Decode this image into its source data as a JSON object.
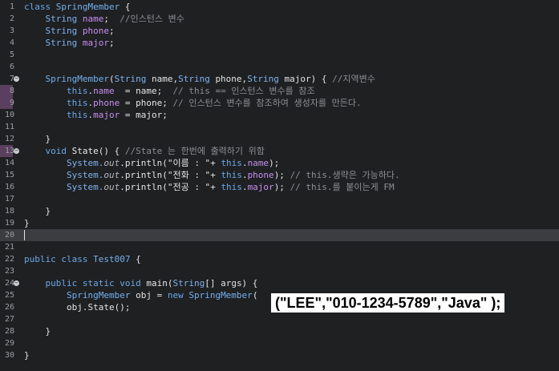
{
  "editor": {
    "lines": [
      {
        "n": "1",
        "fold": false,
        "parts": [
          [
            "kw",
            "class "
          ],
          [
            "cls",
            "SpringMember "
          ],
          [
            "plain",
            "{"
          ]
        ]
      },
      {
        "n": "2",
        "fold": false,
        "parts": [
          [
            "typ",
            "    String "
          ],
          [
            "fld",
            "name"
          ],
          [
            "plain",
            ";  "
          ],
          [
            "cm",
            "//인스턴스 변수"
          ]
        ]
      },
      {
        "n": "3",
        "fold": false,
        "parts": [
          [
            "typ",
            "    String "
          ],
          [
            "fld",
            "phone"
          ],
          [
            "plain",
            ";"
          ]
        ]
      },
      {
        "n": "4",
        "fold": false,
        "parts": [
          [
            "typ",
            "    String "
          ],
          [
            "fld",
            "major"
          ],
          [
            "plain",
            ";"
          ]
        ]
      },
      {
        "n": "5",
        "fold": false,
        "parts": []
      },
      {
        "n": "6",
        "fold": false,
        "parts": []
      },
      {
        "n": "7",
        "fold": true,
        "parts": [
          [
            "cls",
            "    SpringMember"
          ],
          [
            "plain",
            "("
          ],
          [
            "typ",
            "String "
          ],
          [
            "plain",
            "name,"
          ],
          [
            "typ",
            "String "
          ],
          [
            "plain",
            "phone,"
          ],
          [
            "typ",
            "String "
          ],
          [
            "plain",
            "major) { "
          ],
          [
            "cm",
            "//지역변수"
          ]
        ]
      },
      {
        "n": "8",
        "fold": false,
        "mark": true,
        "parts": [
          [
            "kw",
            "        this"
          ],
          [
            "plain",
            "."
          ],
          [
            "fld",
            "name "
          ],
          [
            "plain",
            " = name;  "
          ],
          [
            "cm",
            "// this == 인스턴스 변수를 참조"
          ]
        ]
      },
      {
        "n": "9",
        "fold": false,
        "mark": true,
        "parts": [
          [
            "kw",
            "        this"
          ],
          [
            "plain",
            "."
          ],
          [
            "fld",
            "phone"
          ],
          [
            "plain",
            " = phone; "
          ],
          [
            "cm",
            "// 인스턴스 변수를 참조하여 생성자를 만든다."
          ]
        ]
      },
      {
        "n": "10",
        "fold": false,
        "parts": [
          [
            "kw",
            "        this"
          ],
          [
            "plain",
            "."
          ],
          [
            "fld",
            "major"
          ],
          [
            "plain",
            " = major;"
          ]
        ]
      },
      {
        "n": "11",
        "fold": false,
        "parts": []
      },
      {
        "n": "12",
        "fold": false,
        "parts": [
          [
            "plain",
            "    }"
          ]
        ]
      },
      {
        "n": "13",
        "fold": true,
        "mark": true,
        "parts": [
          [
            "kw",
            "    void "
          ],
          [
            "mth",
            "State"
          ],
          [
            "plain",
            "() { "
          ],
          [
            "cm",
            "//State 는 한번에 출력하기 위함"
          ]
        ]
      },
      {
        "n": "14",
        "fold": false,
        "parts": [
          [
            "typ",
            "        System."
          ],
          [
            "it",
            "out"
          ],
          [
            "plain",
            ".println("
          ],
          [
            "str",
            "\"이름 : \""
          ],
          [
            "plain",
            "+ "
          ],
          [
            "kw",
            "this"
          ],
          [
            "plain",
            "."
          ],
          [
            "fld",
            "name"
          ],
          [
            "plain",
            ");"
          ]
        ]
      },
      {
        "n": "15",
        "fold": false,
        "parts": [
          [
            "typ",
            "        System."
          ],
          [
            "it",
            "out"
          ],
          [
            "plain",
            ".println("
          ],
          [
            "str",
            "\"전화 : \""
          ],
          [
            "plain",
            "+ "
          ],
          [
            "kw",
            "this"
          ],
          [
            "plain",
            "."
          ],
          [
            "fld",
            "phone"
          ],
          [
            "plain",
            "); "
          ],
          [
            "cm",
            "// this.생략은 가능하다."
          ]
        ]
      },
      {
        "n": "16",
        "fold": false,
        "parts": [
          [
            "typ",
            "        System."
          ],
          [
            "it",
            "out"
          ],
          [
            "plain",
            ".println("
          ],
          [
            "str",
            "\"전공 : \""
          ],
          [
            "plain",
            "+ "
          ],
          [
            "kw",
            "this"
          ],
          [
            "plain",
            "."
          ],
          [
            "fld",
            "major"
          ],
          [
            "plain",
            "); "
          ],
          [
            "cm",
            "// this.를 붙이는게 FM"
          ]
        ]
      },
      {
        "n": "17",
        "fold": false,
        "parts": []
      },
      {
        "n": "18",
        "fold": false,
        "parts": [
          [
            "plain",
            "    }"
          ]
        ]
      },
      {
        "n": "19",
        "fold": false,
        "parts": [
          [
            "plain",
            "}"
          ]
        ]
      },
      {
        "n": "20",
        "fold": false,
        "current": true,
        "parts": []
      },
      {
        "n": "21",
        "fold": false,
        "parts": []
      },
      {
        "n": "22",
        "fold": false,
        "parts": [
          [
            "kw",
            "public class "
          ],
          [
            "cls",
            "Test007 "
          ],
          [
            "plain",
            "{"
          ]
        ]
      },
      {
        "n": "23",
        "fold": false,
        "parts": []
      },
      {
        "n": "24",
        "fold": true,
        "parts": [
          [
            "kw",
            "    public static void "
          ],
          [
            "mth",
            "main"
          ],
          [
            "plain",
            "("
          ],
          [
            "typ",
            "String"
          ],
          [
            "plain",
            "[] args) {"
          ]
        ]
      },
      {
        "n": "25",
        "fold": false,
        "parts": [
          [
            "cls",
            "        SpringMember "
          ],
          [
            "plain",
            "obj = "
          ],
          [
            "kw",
            "new "
          ],
          [
            "cls",
            "SpringMember"
          ],
          [
            "plain",
            "("
          ]
        ]
      },
      {
        "n": "26",
        "fold": false,
        "parts": [
          [
            "plain",
            "        obj.State();"
          ]
        ]
      },
      {
        "n": "27",
        "fold": false,
        "parts": []
      },
      {
        "n": "28",
        "fold": false,
        "parts": [
          [
            "plain",
            "    }"
          ]
        ]
      },
      {
        "n": "29",
        "fold": false,
        "parts": []
      },
      {
        "n": "30",
        "fold": false,
        "parts": [
          [
            "plain",
            "}"
          ]
        ]
      }
    ]
  },
  "overlay_text": "(\"LEE\",\"010-1234-5789\",\"Java\" );"
}
